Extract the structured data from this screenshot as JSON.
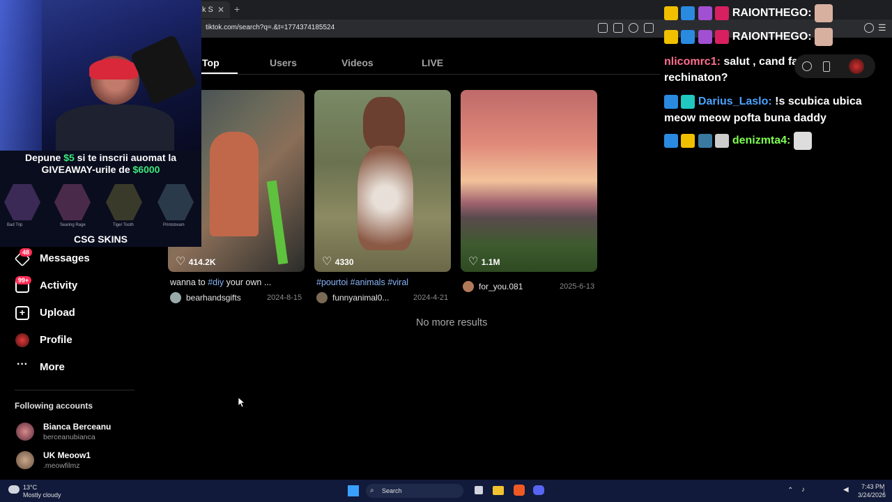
{
  "browser": {
    "tab_partial": "k S",
    "url": "tiktok.com/search?q=.&t=1774374185524"
  },
  "search_tabs": [
    {
      "label": "Top",
      "active": true
    },
    {
      "label": "Users",
      "active": false
    },
    {
      "label": "Videos",
      "active": false
    },
    {
      "label": "LIVE",
      "active": false
    }
  ],
  "results": [
    {
      "likes": "414.2K",
      "caption_text": "wanna to ",
      "caption_tags": [
        "#diy"
      ],
      "caption_rest": " your own ...",
      "author": "bearhandsgifts",
      "date": "2024-8-15"
    },
    {
      "likes": "4330",
      "caption_text": "",
      "caption_tags": [
        "#pourtoi",
        "#animals",
        "#viral"
      ],
      "caption_rest": "",
      "author": "funnyanimal0...",
      "date": "2024-4-21"
    },
    {
      "likes": "1.1M",
      "caption_text": "",
      "caption_tags": [],
      "caption_rest": "",
      "author": "for_you.081",
      "date": "2025-6-13"
    }
  ],
  "no_more": "No more results",
  "sidebar": {
    "messages": {
      "label": "Messages",
      "badge": "48"
    },
    "activity": {
      "label": "Activity",
      "badge": "99+"
    },
    "upload": {
      "label": "Upload"
    },
    "profile": {
      "label": "Profile"
    },
    "more": {
      "label": "More"
    },
    "following_title": "Following accounts",
    "following": [
      {
        "name": "Bianca Berceanu",
        "handle": "berceanubianca"
      },
      {
        "name": "UK Meoow1",
        "handle": ".meowfilmz"
      }
    ]
  },
  "promo": {
    "line1_a": "Depune ",
    "line1_amount": "$5",
    "line1_b": " si te inscrii auomat la",
    "line2_a": "GIVEAWAY-urile de ",
    "line2_amount": "$6000",
    "skins": [
      "Bad Trip",
      "Searing Rage",
      "Tiger Tooth",
      "Printstream"
    ],
    "brand": "CSG SKINS"
  },
  "chat": [
    {
      "user": "RAIONTHEGO:",
      "text": "",
      "color": "#ffffff"
    },
    {
      "user": "RAIONTHEGO:",
      "text": "",
      "color": "#ffffff"
    },
    {
      "user": "nlicomrc1:",
      "text": "salut , cand faci rechinaton?",
      "color": "#ff6f8f"
    },
    {
      "user": "Darius_Laslo:",
      "text": "!s scubica ubica meow meow pofta buna daddy",
      "color": "#4aa3ff"
    },
    {
      "user": "denizmta4:",
      "text": "",
      "color": "#7fff50"
    }
  ],
  "taskbar": {
    "temp": "13°C",
    "weather": "Mostly cloudy",
    "search": "Search",
    "time": "7:43 PM",
    "date": "3/24/2026"
  },
  "colors": {
    "accent": "#fe2c55",
    "link": "#8ab4f8"
  }
}
